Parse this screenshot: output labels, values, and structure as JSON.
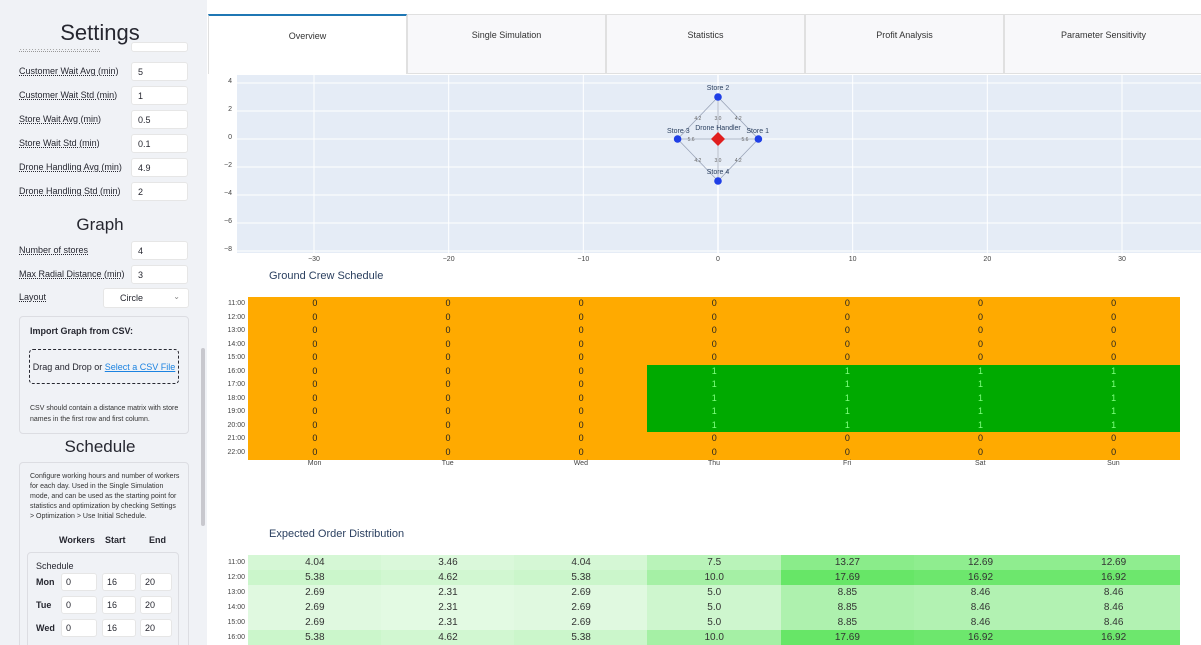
{
  "sidebar": {
    "title": "Settings",
    "top_fields": [
      {
        "label": "Customer Wait Avg (min)",
        "value": "5"
      },
      {
        "label": "Customer Wait Std (min)",
        "value": "1"
      },
      {
        "label": "Store Wait Avg (min)",
        "value": "0.5"
      },
      {
        "label": "Store Wait Std (min)",
        "value": "0.1"
      },
      {
        "label": "Drone Handling Avg (min)",
        "value": "4.9"
      },
      {
        "label": "Drone Handling Std (min)",
        "value": "2"
      }
    ],
    "graph_title": "Graph",
    "graph_fields": [
      {
        "label": "Number of stores",
        "value": "4"
      },
      {
        "label": "Max Radial Distance (min)",
        "value": "3"
      }
    ],
    "layout_label": "Layout",
    "layout_value": "Circle",
    "import_title": "Import Graph from CSV:",
    "drop_text": "Drag and Drop or ",
    "drop_link": "Select a CSV File",
    "import_note_1": "CSV should contain a distance matrix with store",
    "import_note_2": "names in the first row and first column.",
    "schedule_title": "Schedule",
    "schedule_note": [
      "Configure working hours and number of workers",
      "for each day. Used in the Single Simulation",
      "mode, and can be used as the starting point for",
      "statistics and optimization by checking Settings",
      "> Optimization > Use Initial Schedule."
    ],
    "schedule_headers": {
      "workers": "Workers",
      "start": "Start",
      "end": "End"
    },
    "schedule_label": "Schedule",
    "schedule_rows": [
      {
        "day": "Mon",
        "workers": "0",
        "start": "16",
        "end": "20"
      },
      {
        "day": "Tue",
        "workers": "0",
        "start": "16",
        "end": "20"
      },
      {
        "day": "Wed",
        "workers": "0",
        "start": "16",
        "end": "20"
      }
    ]
  },
  "tabs": [
    "Overview",
    "Single Simulation",
    "Statistics",
    "Profit Analysis",
    "Parameter Sensitivity"
  ],
  "graph": {
    "y_ticks": [
      "4",
      "2",
      "0",
      "−2",
      "−4",
      "−6",
      "−8"
    ],
    "x_ticks": [
      "−30",
      "−20",
      "−10",
      "0",
      "10",
      "20",
      "30"
    ],
    "nodes": [
      {
        "name": "Store 2",
        "x": 0,
        "y": 3
      },
      {
        "name": "Store 3",
        "x": -3,
        "y": 0
      },
      {
        "name": "Store 1",
        "x": 3,
        "y": 0
      },
      {
        "name": "Store 4",
        "x": 0,
        "y": -3
      }
    ],
    "handler": {
      "name": "Drone Handler",
      "x": 0,
      "y": 0
    },
    "edge_labels": [
      "4.2",
      "3.0",
      "4.2",
      "5.6",
      "5.6",
      "4.2",
      "3.0",
      "4.2"
    ],
    "node_color": "#1f3fe6",
    "handler_color": "#e01e1e"
  },
  "crew": {
    "title": "Ground Crew Schedule",
    "hours": [
      "11:00",
      "12:00",
      "13:00",
      "14:00",
      "15:00",
      "16:00",
      "17:00",
      "18:00",
      "19:00",
      "20:00",
      "21:00",
      "22:00"
    ],
    "days": [
      "Mon",
      "Tue",
      "Wed",
      "Thu",
      "Fri",
      "Sat",
      "Sun"
    ],
    "values": [
      [
        0,
        0,
        0,
        0,
        0,
        0,
        0
      ],
      [
        0,
        0,
        0,
        0,
        0,
        0,
        0
      ],
      [
        0,
        0,
        0,
        0,
        0,
        0,
        0
      ],
      [
        0,
        0,
        0,
        0,
        0,
        0,
        0
      ],
      [
        0,
        0,
        0,
        0,
        0,
        0,
        0
      ],
      [
        0,
        0,
        0,
        1,
        1,
        1,
        1
      ],
      [
        0,
        0,
        0,
        1,
        1,
        1,
        1
      ],
      [
        0,
        0,
        0,
        1,
        1,
        1,
        1
      ],
      [
        0,
        0,
        0,
        1,
        1,
        1,
        1
      ],
      [
        0,
        0,
        0,
        1,
        1,
        1,
        1
      ],
      [
        0,
        0,
        0,
        0,
        0,
        0,
        0
      ],
      [
        0,
        0,
        0,
        0,
        0,
        0,
        0
      ]
    ],
    "color_zero": "#ffaa00",
    "color_one": "#00aa00"
  },
  "orders": {
    "title": "Expected Order Distribution",
    "hours": [
      "11:00",
      "12:00",
      "13:00",
      "14:00",
      "15:00",
      "16:00"
    ],
    "values": [
      [
        "4.04",
        "3.46",
        "4.04",
        "7.5",
        "13.27",
        "12.69",
        "12.69"
      ],
      [
        "5.38",
        "4.62",
        "5.38",
        "10.0",
        "17.69",
        "16.92",
        "16.92"
      ],
      [
        "2.69",
        "2.31",
        "2.69",
        "5.0",
        "8.85",
        "8.46",
        "8.46"
      ],
      [
        "2.69",
        "2.31",
        "2.69",
        "5.0",
        "8.85",
        "8.46",
        "8.46"
      ],
      [
        "2.69",
        "2.31",
        "2.69",
        "5.0",
        "8.85",
        "8.46",
        "8.46"
      ],
      [
        "5.38",
        "4.62",
        "5.38",
        "10.0",
        "17.69",
        "16.92",
        "16.92"
      ]
    ]
  }
}
